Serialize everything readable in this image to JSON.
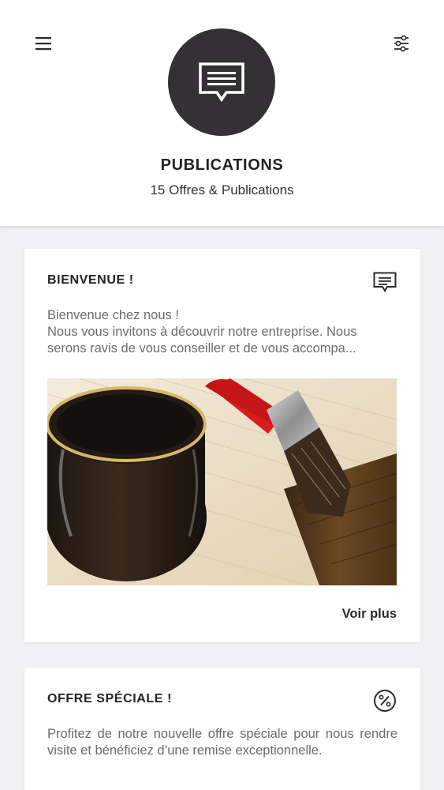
{
  "header": {
    "title": "PUBLICATIONS",
    "subtitle": "15 Offres & Publications",
    "menu_icon": "hamburger-menu-icon",
    "filter_icon": "sliders-filter-icon",
    "hero_icon": "message-bubble-icon"
  },
  "publications": [
    {
      "title": "BIENVENUE !",
      "icon": "message-bubble-icon",
      "text_lines": [
        "Bienvenue chez nous !",
        "Nous vous invitons à découvrir notre entreprise. Nous",
        "serons ravis de vous conseiller et de vous accompa..."
      ],
      "image": "paint-jar-and-brush-photo",
      "more_label": "Voir plus"
    },
    {
      "title": "OFFRE SPÉCIALE !",
      "icon": "percent-badge-icon",
      "text": "Profitez de notre nouvelle offre spéciale pour nous rendre visite et bénéficiez d’une remise exceptionnelle."
    }
  ],
  "colors": {
    "background": "#f1f0f3",
    "surface": "#ffffff",
    "hero_circle": "#333133",
    "text_dark": "#232224",
    "text_muted": "#6b6a6e",
    "brush_red": "#d81d1d"
  }
}
